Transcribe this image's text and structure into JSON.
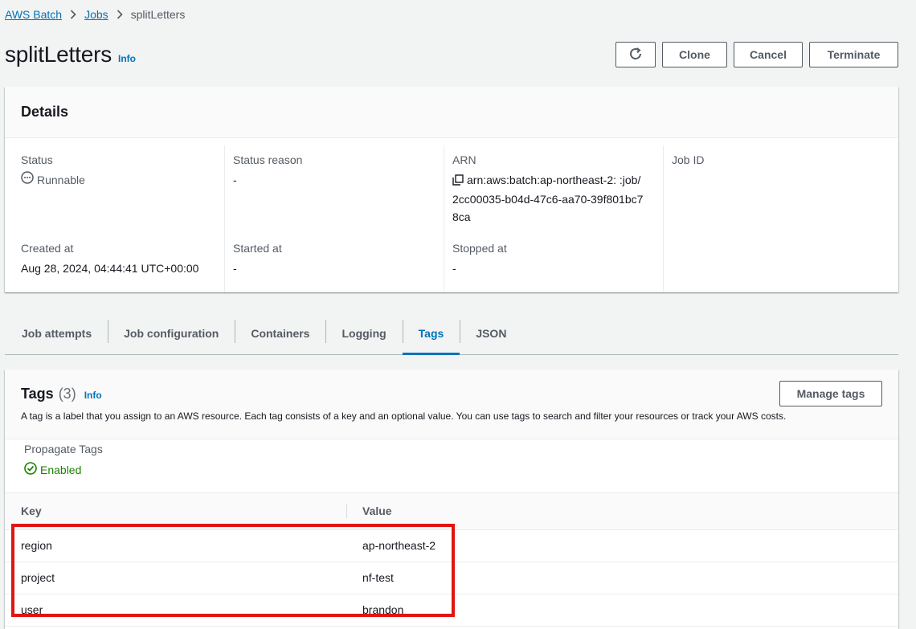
{
  "breadcrumb": {
    "items": [
      "AWS Batch",
      "Jobs"
    ],
    "current": "splitLetters"
  },
  "header": {
    "title": "splitLetters",
    "info": "Info",
    "actions": {
      "refresh_icon": "refresh-icon",
      "clone": "Clone",
      "cancel": "Cancel",
      "terminate": "Terminate"
    }
  },
  "details": {
    "title": "Details",
    "status": {
      "label": "Status",
      "value": "Runnable",
      "icon": "pending-icon"
    },
    "status_reason": {
      "label": "Status reason",
      "value": "-"
    },
    "arn": {
      "label": "ARN",
      "value": "arn:aws:batch:ap-northeast-2:                    :job/2cc00035-b04d-47c6-aa70-39f801bc78ca"
    },
    "job_id": {
      "label": "Job ID",
      "value": ""
    },
    "created_at": {
      "label": "Created at",
      "value": "Aug 28, 2024, 04:44:41 UTC+00:00"
    },
    "started_at": {
      "label": "Started at",
      "value": "-"
    },
    "stopped_at": {
      "label": "Stopped at",
      "value": "-"
    }
  },
  "tabs": [
    {
      "label": "Job attempts",
      "active": false
    },
    {
      "label": "Job configuration",
      "active": false
    },
    {
      "label": "Containers",
      "active": false
    },
    {
      "label": "Logging",
      "active": false
    },
    {
      "label": "Tags",
      "active": true
    },
    {
      "label": "JSON",
      "active": false
    }
  ],
  "tags": {
    "title": "Tags",
    "count": "(3)",
    "info": "Info",
    "description": "A tag is a label that you assign to an AWS resource. Each tag consists of a key and an optional value. You can use tags to search and filter your resources or track your AWS costs.",
    "manage_button": "Manage tags",
    "propagate": {
      "label": "Propagate Tags",
      "value": "Enabled"
    },
    "columns": {
      "key": "Key",
      "value": "Value"
    },
    "rows": [
      {
        "key": "region",
        "value": "ap-northeast-2"
      },
      {
        "key": "project",
        "value": "nf-test"
      },
      {
        "key": "user",
        "value": "brandon"
      }
    ]
  },
  "colors": {
    "link": "#0073bb",
    "success": "#1d8102",
    "highlight": "#e11414"
  }
}
